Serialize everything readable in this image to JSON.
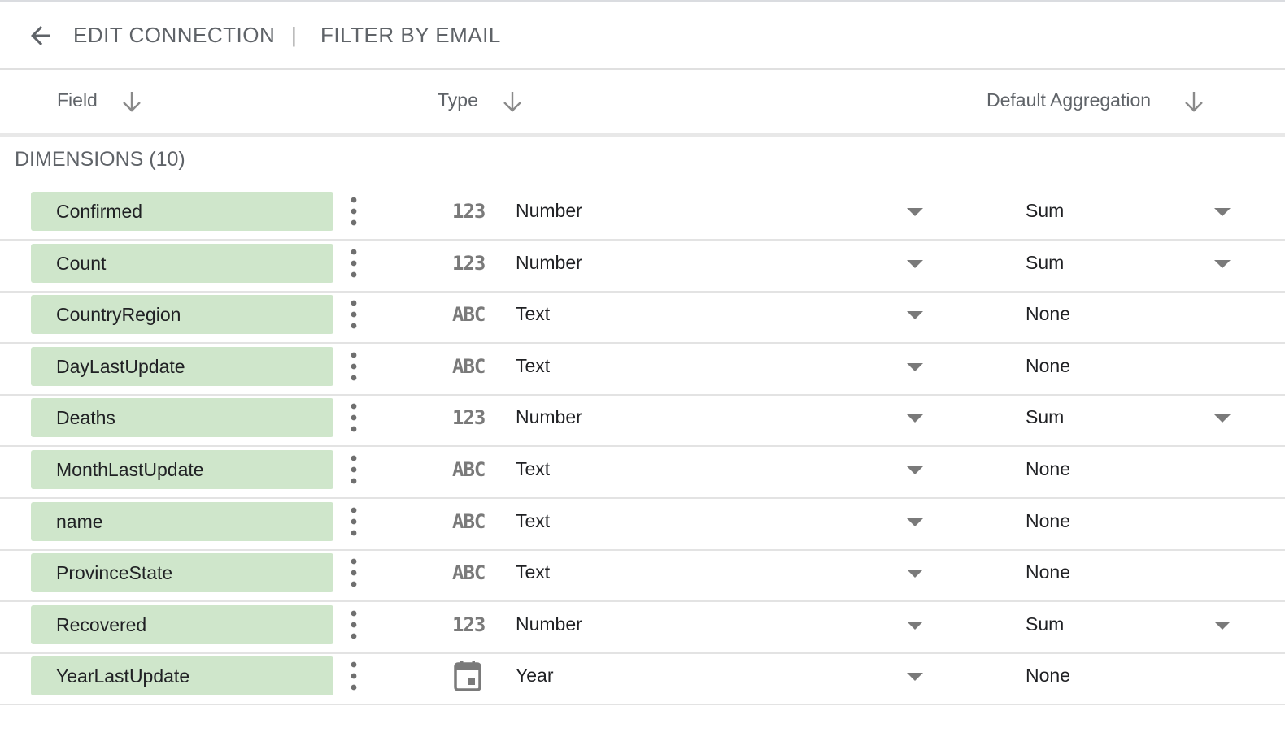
{
  "header": {
    "back_icon": "arrow-back-icon",
    "edit_connection": "EDIT CONNECTION",
    "separator": "|",
    "filter_by_email": "FILTER BY EMAIL"
  },
  "columns": {
    "field": "Field",
    "type": "Type",
    "default_aggregation": "Default Aggregation",
    "sort_icon": "arrow-down-icon"
  },
  "section": {
    "label": "DIMENSIONS (10)"
  },
  "colors": {
    "chip_background": "#cfe6cb",
    "header_text": "#5f6368",
    "icon_gray": "#7a7a7a"
  },
  "rows": [
    {
      "field": "Confirmed",
      "type_icon": "123",
      "type": "Number",
      "aggregation": "Sum",
      "aggregation_dropdown": true
    },
    {
      "field": "Count",
      "type_icon": "123",
      "type": "Number",
      "aggregation": "Sum",
      "aggregation_dropdown": true
    },
    {
      "field": "CountryRegion",
      "type_icon": "ABC",
      "type": "Text",
      "aggregation": "None",
      "aggregation_dropdown": false
    },
    {
      "field": "DayLastUpdate",
      "type_icon": "ABC",
      "type": "Text",
      "aggregation": "None",
      "aggregation_dropdown": false
    },
    {
      "field": "Deaths",
      "type_icon": "123",
      "type": "Number",
      "aggregation": "Sum",
      "aggregation_dropdown": true
    },
    {
      "field": "MonthLastUpdate",
      "type_icon": "ABC",
      "type": "Text",
      "aggregation": "None",
      "aggregation_dropdown": false
    },
    {
      "field": "name",
      "type_icon": "ABC",
      "type": "Text",
      "aggregation": "None",
      "aggregation_dropdown": false
    },
    {
      "field": "ProvinceState",
      "type_icon": "ABC",
      "type": "Text",
      "aggregation": "None",
      "aggregation_dropdown": false
    },
    {
      "field": "Recovered",
      "type_icon": "123",
      "type": "Number",
      "aggregation": "Sum",
      "aggregation_dropdown": true
    },
    {
      "field": "YearLastUpdate",
      "type_icon": "calendar-icon",
      "type": "Year",
      "aggregation": "None",
      "aggregation_dropdown": false
    }
  ]
}
